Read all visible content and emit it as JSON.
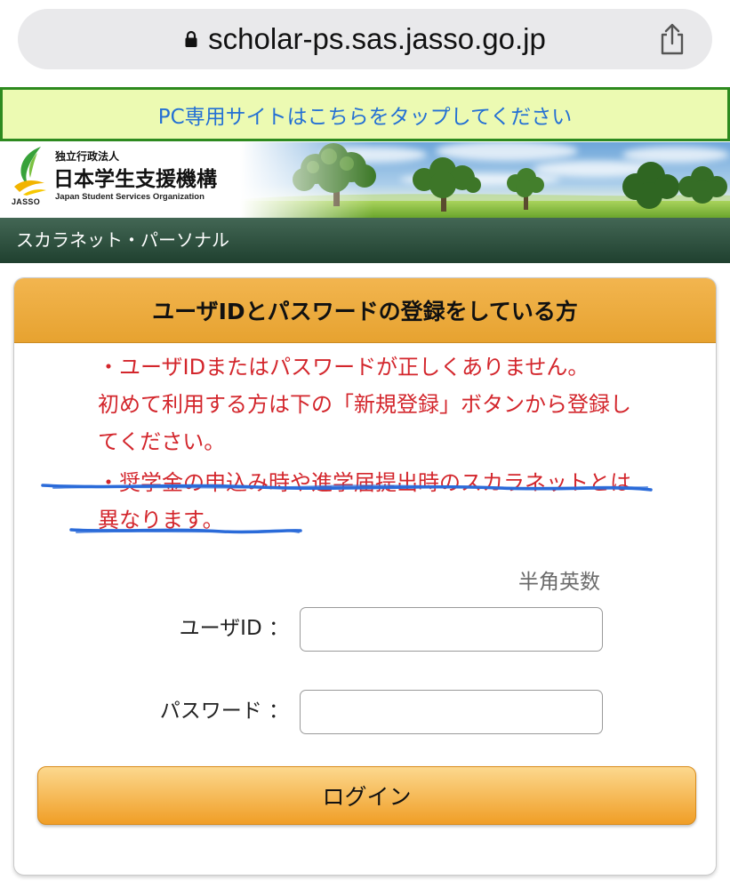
{
  "browser": {
    "url": "scholar-ps.sas.jasso.go.jp"
  },
  "icons": {
    "lock": "lock-icon",
    "share": "share-icon",
    "logo": "jasso-logo"
  },
  "pc_banner": {
    "text": "PC専用サイトはこちらをタップしてください"
  },
  "header": {
    "org_type": "独立行政法人",
    "org_name": "日本学生支援機構",
    "org_name_en": "Japan Student Services Organization",
    "logo_text": "JASSO"
  },
  "nav": {
    "title": "スカラネット・パーソナル"
  },
  "login_card": {
    "title": "ユーザIDとパスワードの登録をしている方",
    "errors": [
      {
        "lines": [
          "・ユーザIDまたはパスワードが正しくありません。",
          "初めて利用する方は下の「新規登録」ボタンから登録し",
          "てください。"
        ]
      },
      {
        "lines": [
          "・奨学金の申込み時や進学届提出時のスカラネットとは",
          "異なります。"
        ]
      }
    ],
    "input_hint": "半角英数",
    "user_id": {
      "label": "ユーザID ：",
      "value": ""
    },
    "password": {
      "label": "パスワード ：",
      "value": ""
    },
    "login_button": "ログイン"
  },
  "colors": {
    "banner_text": "#2470d4",
    "banner_bg": "#ecfab2",
    "banner_border": "#2d8a1f",
    "nav_bg": "#27503b",
    "card_header": "#f0a932",
    "error_text": "#d3262c",
    "login_button": "#f09e26",
    "annotation": "#2b6bd9"
  }
}
